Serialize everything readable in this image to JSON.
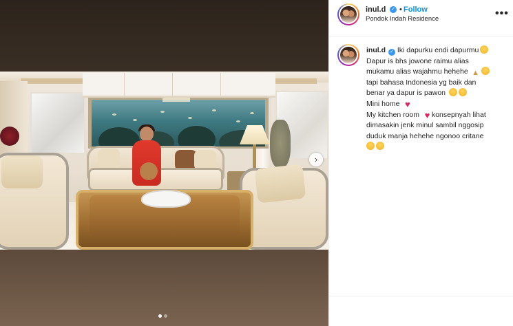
{
  "post": {
    "username": "inul.d",
    "follow_label": "Follow",
    "separator": "•",
    "location": "Pondok Indah Residence",
    "more_icon": "•••",
    "verified_icon": "✓",
    "carousel": {
      "next_arrow": "›",
      "slide_count": 2,
      "active_slide": 1
    }
  },
  "caption": {
    "username": "inul.d",
    "lines": [
      "Iki dapurku endi dapurmu",
      "Dapur is bhs jowone raimu alias",
      "mukamu alias wajahmu hehehe",
      "tapi bahasa Indonesia yg baik dan",
      "benar ya dapur is pawon",
      "Mini home",
      "My kitchen room",
      "konsepnyah lihat",
      "dimasakin jenk minul sambil nggosip",
      "duduk manja hehehe ngonoo critane"
    ]
  },
  "colors": {
    "accent_blue": "#0095f6",
    "verified_blue": "#3897f0",
    "heart_red": "#e0245e",
    "text": "#262626"
  }
}
